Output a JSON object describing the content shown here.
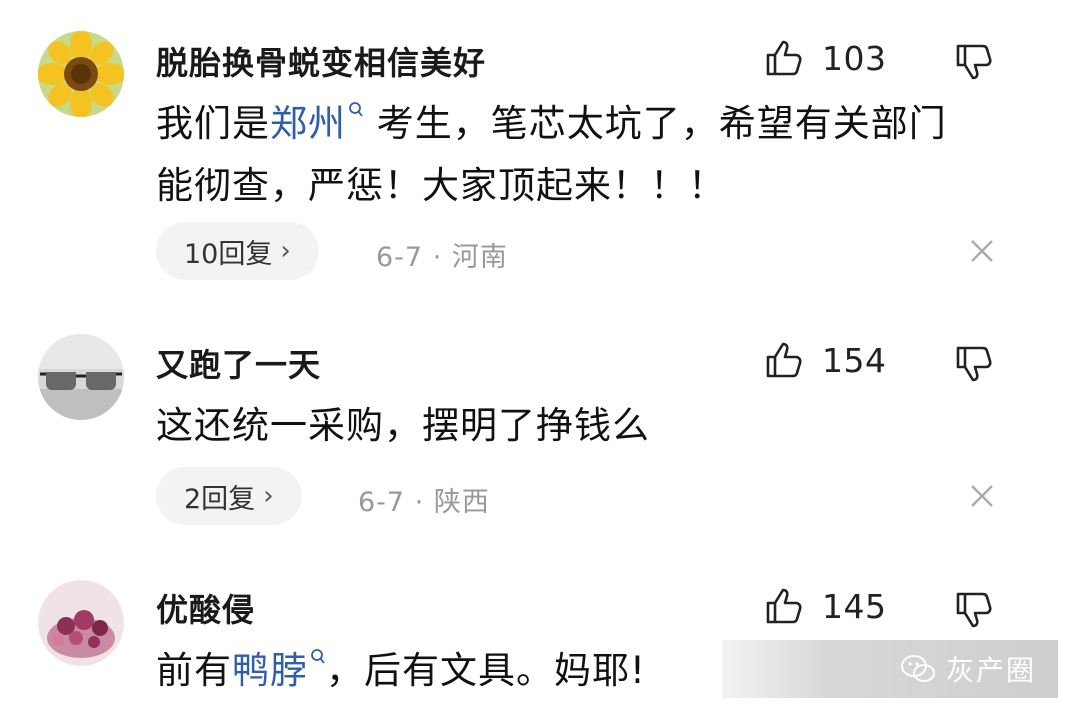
{
  "comments": [
    {
      "username": "脱胎换骨蜕变相信美好",
      "likes": "103",
      "text_part1": "我们是",
      "keyword": "郑州",
      "text_part2": " 考生，笔芯太坑了，希望有关部门能彻查，严惩！大家顶起来！！！",
      "reply_label": "10回复",
      "date": "6-7",
      "location": "河南",
      "avatar_icon": "sunflower-avatar"
    },
    {
      "username": "又跑了一天",
      "likes": "154",
      "text": "这还统一采购，摆明了挣钱么",
      "reply_label": "2回复",
      "date": "6-7",
      "location": "陕西",
      "avatar_icon": "glasses-avatar"
    },
    {
      "username": "优酸侵",
      "likes": "145",
      "text_part1": "前有",
      "keyword": "鸭脖",
      "text_part2": "，后有文具。妈耶!",
      "avatar_icon": "berries-avatar"
    }
  ],
  "watermark": {
    "text": "灰产圈",
    "icon": "wechat-icon"
  },
  "colors": {
    "keyword": "#2f5fa8",
    "meta": "#999999",
    "pill_bg": "#f3f3f3"
  },
  "icons": {
    "like": "thumbs-up-icon",
    "dislike": "thumbs-down-icon",
    "close": "close-icon",
    "chevron": "chevron-right-icon",
    "search": "search-icon"
  }
}
